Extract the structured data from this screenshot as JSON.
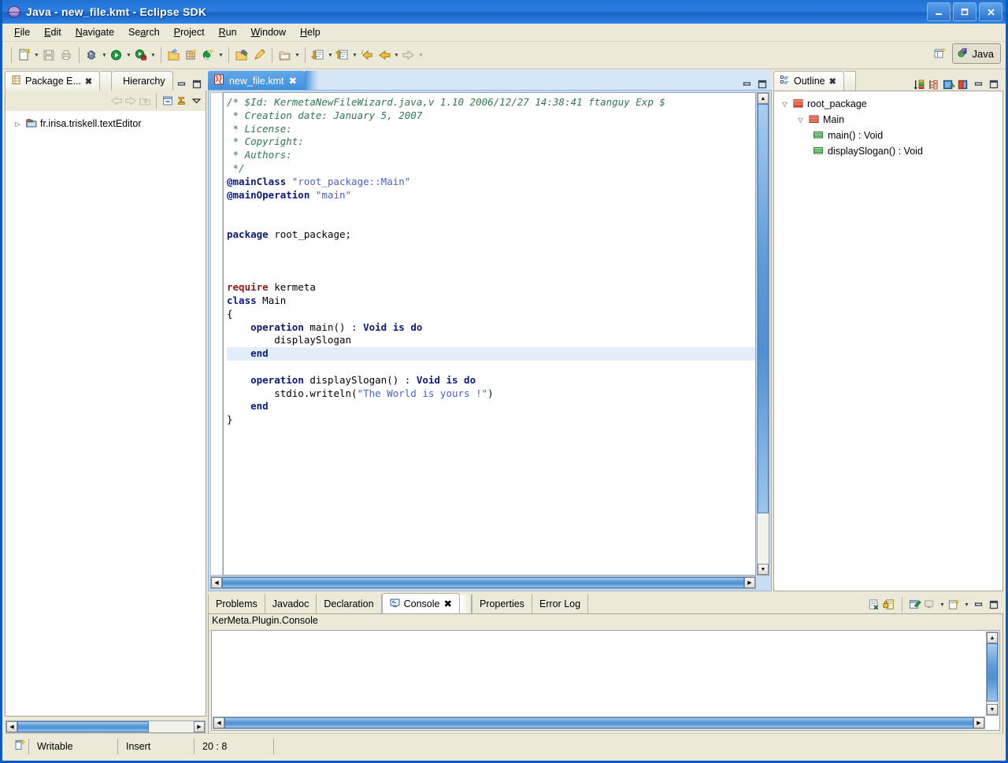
{
  "window": {
    "title": "Java - new_file.kmt - Eclipse SDK",
    "icon": "eclipse-icon",
    "minimize_label": "–",
    "maximize_label": "❐",
    "close_label": "✕"
  },
  "menubar": [
    {
      "label": "File",
      "mnemonic": "F"
    },
    {
      "label": "Edit",
      "mnemonic": "E"
    },
    {
      "label": "Navigate",
      "mnemonic": "N"
    },
    {
      "label": "Search",
      "mnemonic": "a"
    },
    {
      "label": "Project",
      "mnemonic": "P"
    },
    {
      "label": "Run",
      "mnemonic": "R"
    },
    {
      "label": "Window",
      "mnemonic": "W"
    },
    {
      "label": "Help",
      "mnemonic": "H"
    }
  ],
  "toolbar": {
    "groups": [
      [
        "new-wizard-icon",
        "save-icon",
        "print-icon"
      ],
      [
        "debug-icon",
        "run-icon",
        "external-tools-icon"
      ],
      [
        "new-java-project-icon",
        "new-package-icon",
        "new-class-icon"
      ],
      [
        "open-type-icon",
        "search-icon"
      ],
      [
        "open-resource-icon"
      ],
      [
        "next-annotation-icon",
        "previous-annotation-icon",
        "last-edit-location-icon",
        "back-icon",
        "forward-icon"
      ]
    ],
    "perspective": {
      "open_perspective_icon": "open-perspective-icon",
      "active_label": "Java",
      "active_icon": "java-perspective-icon"
    }
  },
  "package_explorer": {
    "tabs": [
      {
        "label": "Package E...",
        "icon": "package-explorer-icon",
        "closable": true,
        "active": true
      },
      {
        "label": "Hierarchy",
        "icon": "hierarchy-icon",
        "closable": false,
        "active": false
      }
    ],
    "view_buttons": [
      "minimize-icon",
      "maximize-icon"
    ],
    "toolbar_icons": [
      "back-icon",
      "forward-icon",
      "up-icon",
      "collapse-all-icon",
      "link-with-editor-icon",
      "view-menu-icon"
    ],
    "tree": [
      {
        "label": "fr.irisa.triskell.textEditor",
        "icon": "java-project-icon",
        "expanded": false,
        "depth": 0
      }
    ]
  },
  "editor": {
    "tab": {
      "label": "new_file.kmt",
      "icon": "kermeta-file-icon",
      "closable": true,
      "dirty": false
    },
    "view_buttons": [
      "minimize-icon",
      "maximize-icon"
    ],
    "code_lines": [
      {
        "tokens": [
          {
            "t": "comment",
            "s": "/* $Id: KermetaNewFileWizard.java,v 1.10 2006/12/27 14:38:41 ftanguy Exp $"
          }
        ]
      },
      {
        "tokens": [
          {
            "t": "comment",
            "s": " * Creation date: January 5, 2007"
          }
        ]
      },
      {
        "tokens": [
          {
            "t": "comment",
            "s": " * License:"
          }
        ]
      },
      {
        "tokens": [
          {
            "t": "comment",
            "s": " * Copyright:"
          }
        ]
      },
      {
        "tokens": [
          {
            "t": "comment",
            "s": " * Authors:"
          }
        ]
      },
      {
        "tokens": [
          {
            "t": "comment",
            "s": " */"
          }
        ]
      },
      {
        "tokens": [
          {
            "t": "kw",
            "s": "@mainClass"
          },
          {
            "t": "plain",
            "s": " "
          },
          {
            "t": "str",
            "s": "\"root_package::Main\""
          }
        ]
      },
      {
        "tokens": [
          {
            "t": "kw",
            "s": "@mainOperation"
          },
          {
            "t": "plain",
            "s": " "
          },
          {
            "t": "str",
            "s": "\"main\""
          }
        ]
      },
      {
        "tokens": []
      },
      {
        "tokens": []
      },
      {
        "tokens": [
          {
            "t": "kw",
            "s": "package"
          },
          {
            "t": "plain",
            "s": " root_package;"
          }
        ]
      },
      {
        "tokens": []
      },
      {
        "tokens": []
      },
      {
        "tokens": []
      },
      {
        "tokens": [
          {
            "t": "kw2",
            "s": "require"
          },
          {
            "t": "plain",
            "s": " kermeta"
          }
        ]
      },
      {
        "tokens": [
          {
            "t": "kw",
            "s": "class"
          },
          {
            "t": "plain",
            "s": " Main"
          }
        ]
      },
      {
        "tokens": [
          {
            "t": "plain",
            "s": "{"
          }
        ]
      },
      {
        "tokens": [
          {
            "t": "plain",
            "s": "    "
          },
          {
            "t": "kw",
            "s": "operation"
          },
          {
            "t": "plain",
            "s": " main() : "
          },
          {
            "t": "kw",
            "s": "Void is do"
          }
        ]
      },
      {
        "tokens": [
          {
            "t": "plain",
            "s": "        displaySlogan"
          }
        ]
      },
      {
        "tokens": [
          {
            "t": "plain",
            "s": "    "
          },
          {
            "t": "kw",
            "s": "end"
          }
        ],
        "highlight": true
      },
      {
        "tokens": []
      },
      {
        "tokens": [
          {
            "t": "plain",
            "s": "    "
          },
          {
            "t": "kw",
            "s": "operation"
          },
          {
            "t": "plain",
            "s": " displaySlogan() : "
          },
          {
            "t": "kw",
            "s": "Void is do"
          }
        ]
      },
      {
        "tokens": [
          {
            "t": "plain",
            "s": "        stdio.writeln("
          },
          {
            "t": "str",
            "s": "\"The World is yours !\""
          },
          {
            "t": "plain",
            "s": ")"
          }
        ]
      },
      {
        "tokens": [
          {
            "t": "plain",
            "s": "    "
          },
          {
            "t": "kw",
            "s": "end"
          }
        ]
      },
      {
        "tokens": [
          {
            "t": "plain",
            "s": "}"
          }
        ]
      }
    ]
  },
  "outline": {
    "tab": {
      "label": "Outline",
      "icon": "outline-icon",
      "closable": true
    },
    "toolbar_icons": [
      "sort-icon",
      "hide-fields-icon",
      "hide-static-icon",
      "hide-non-public-icon"
    ],
    "view_buttons": [
      "minimize-icon",
      "maximize-icon"
    ],
    "tree": [
      {
        "label": "root_package",
        "icon": "package-icon",
        "depth": 0,
        "expanded": true
      },
      {
        "label": "Main",
        "icon": "class-icon",
        "depth": 1,
        "expanded": true
      },
      {
        "label": "main() : Void",
        "icon": "operation-icon",
        "depth": 2,
        "expanded": null
      },
      {
        "label": "displaySlogan() : Void",
        "icon": "operation-icon",
        "depth": 2,
        "expanded": null
      }
    ]
  },
  "bottom_panel": {
    "tabs": [
      {
        "label": "Problems",
        "active": false,
        "icon": null,
        "closable": false
      },
      {
        "label": "Javadoc",
        "active": false,
        "icon": null,
        "closable": false
      },
      {
        "label": "Declaration",
        "active": false,
        "icon": null,
        "closable": false
      },
      {
        "label": "Console",
        "active": true,
        "icon": "console-icon",
        "closable": true
      },
      {
        "label": "Properties",
        "active": false,
        "icon": null,
        "closable": false
      },
      {
        "label": "Error Log",
        "active": false,
        "icon": null,
        "closable": false
      }
    ],
    "toolbar_icons": [
      "clear-console-icon",
      "scroll-lock-icon",
      "pin-console-icon",
      "display-console-icon",
      "open-console-icon"
    ],
    "view_buttons": [
      "minimize-icon",
      "maximize-icon"
    ],
    "console_title": "KerMeta.Plugin.Console",
    "console_text": ""
  },
  "statusbar": {
    "left_icon": "editing-icon",
    "cells": [
      "Writable",
      "Insert",
      "20 : 8"
    ]
  },
  "colors": {
    "title_blue": "#1e72d4",
    "chrome": "#ece9d8",
    "tab_active_blue": "#3f8fdd",
    "comment_green": "#2d7a4d",
    "keyword_navy": "#0c1b7a",
    "keyword_red": "#8b1a1a",
    "string_blue": "#4a63c8",
    "current_line": "#e3eefc"
  }
}
